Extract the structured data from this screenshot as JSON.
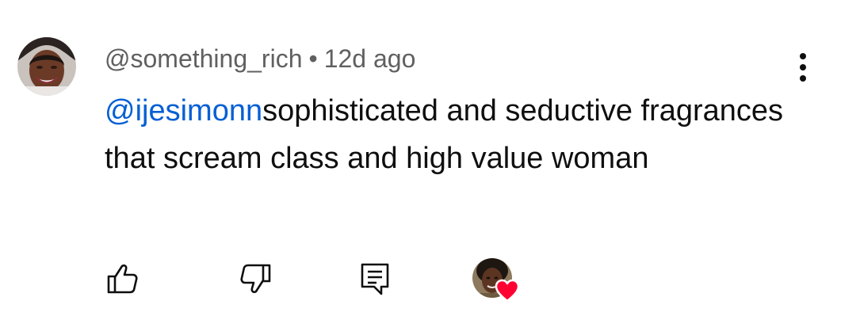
{
  "comment": {
    "author_handle": "@something_rich",
    "separator": "•",
    "timestamp": "12d ago",
    "mention": "@ijesimonn",
    "body": "sophisticated and seductive fragrances that scream class and high value woman"
  },
  "icons": {
    "more": "vertical-dots-icon",
    "like": "thumbs-up-icon",
    "dislike": "thumbs-down-icon",
    "reply": "comment-icon",
    "heart": "heart-icon"
  },
  "colors": {
    "mention": "#065fd4",
    "meta": "#606060",
    "text": "#0f0f0f",
    "heart": "#ff0033"
  }
}
